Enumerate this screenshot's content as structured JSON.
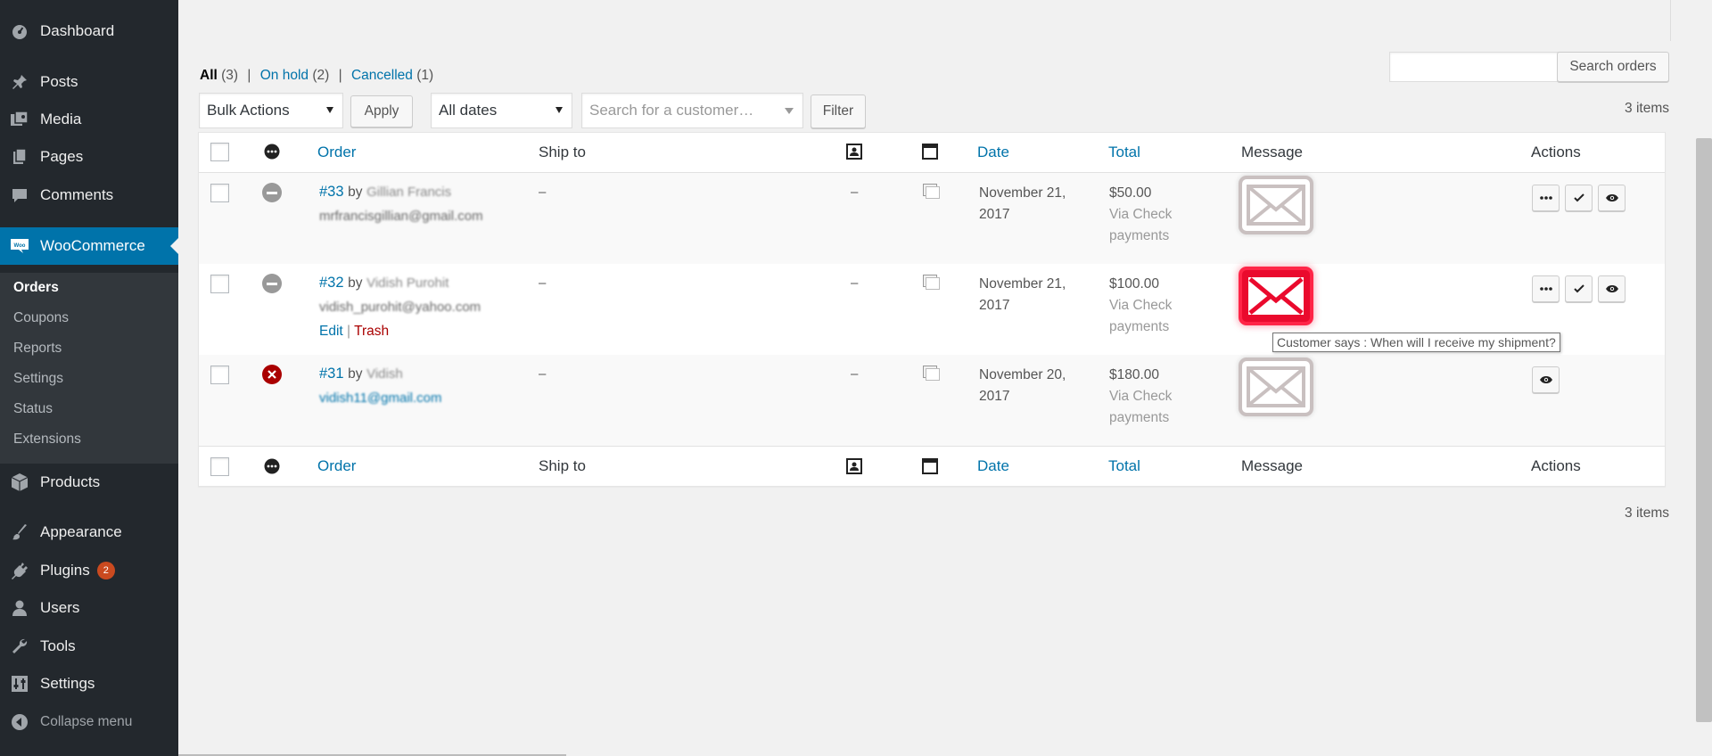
{
  "sidebar": {
    "items": [
      {
        "label": "Dashboard",
        "icon": "dashboard-icon"
      },
      {
        "label": "Posts",
        "icon": "pin-icon"
      },
      {
        "label": "Media",
        "icon": "media-icon"
      },
      {
        "label": "Pages",
        "icon": "pages-icon"
      },
      {
        "label": "Comments",
        "icon": "comment-icon"
      },
      {
        "label": "WooCommerce",
        "icon": "woo-icon"
      },
      {
        "label": "Products",
        "icon": "products-icon"
      },
      {
        "label": "Appearance",
        "icon": "brush-icon"
      },
      {
        "label": "Plugins",
        "icon": "plugin-icon",
        "badge": "2"
      },
      {
        "label": "Users",
        "icon": "user-icon"
      },
      {
        "label": "Tools",
        "icon": "wrench-icon"
      },
      {
        "label": "Settings",
        "icon": "settings-icon"
      }
    ],
    "submenu": [
      "Orders",
      "Coupons",
      "Reports",
      "Settings",
      "Status",
      "Extensions"
    ],
    "collapse": "Collapse menu"
  },
  "filters": {
    "all": "All",
    "all_count": "(3)",
    "on_hold": "On hold",
    "on_hold_count": "(2)",
    "cancelled": "Cancelled",
    "cancelled_count": "(1)",
    "sep": "|"
  },
  "toolbar": {
    "bulk_actions": "Bulk Actions",
    "apply": "Apply",
    "all_dates": "All dates",
    "customer_placeholder": "Search for a customer…",
    "filter": "Filter",
    "search_orders": "Search orders",
    "items_count": "3 items"
  },
  "table": {
    "headers": {
      "order": "Order",
      "ship_to": "Ship to",
      "date": "Date",
      "total": "Total",
      "message": "Message",
      "actions": "Actions"
    },
    "rows": [
      {
        "order": "#33",
        "by": "by",
        "customer": "Gillian Francis",
        "email": "mrfrancisgillian@gmail.com",
        "ship_to": "–",
        "col6": "–",
        "date_line1": "November 21,",
        "date_line2": "2017",
        "total": "$50.00",
        "via1": "Via Check",
        "via2": "payments",
        "status": "on-hold",
        "message": "none"
      },
      {
        "order": "#32",
        "by": "by",
        "customer": "Vidish Purohit",
        "email": "vidish_purohit@yahoo.com",
        "edit": "Edit",
        "trash": "Trash",
        "sep": "|",
        "ship_to": "–",
        "col6": "–",
        "date_line1": "November 21,",
        "date_line2": "2017",
        "total": "$100.00",
        "via1": "Via Check",
        "via2": "payments",
        "status": "on-hold",
        "message": "new"
      },
      {
        "order": "#31",
        "by": "by",
        "customer": "Vidish",
        "email": "vidish11@gmail.com",
        "ship_to": "–",
        "col6": "–",
        "date_line1": "November 20,",
        "date_line2": "2017",
        "total": "$180.00",
        "via1": "Via Check",
        "via2": "payments",
        "status": "cancelled",
        "message": "none"
      }
    ]
  },
  "tooltip": "Customer says : When will I receive my shipment?",
  "colors": {
    "sidebar_bg": "#23282d",
    "active_bg": "#0073aa",
    "link": "#0073aa",
    "trash": "#a00",
    "envelope_new": "#ea0a2d",
    "badge": "#ca4a1f"
  }
}
